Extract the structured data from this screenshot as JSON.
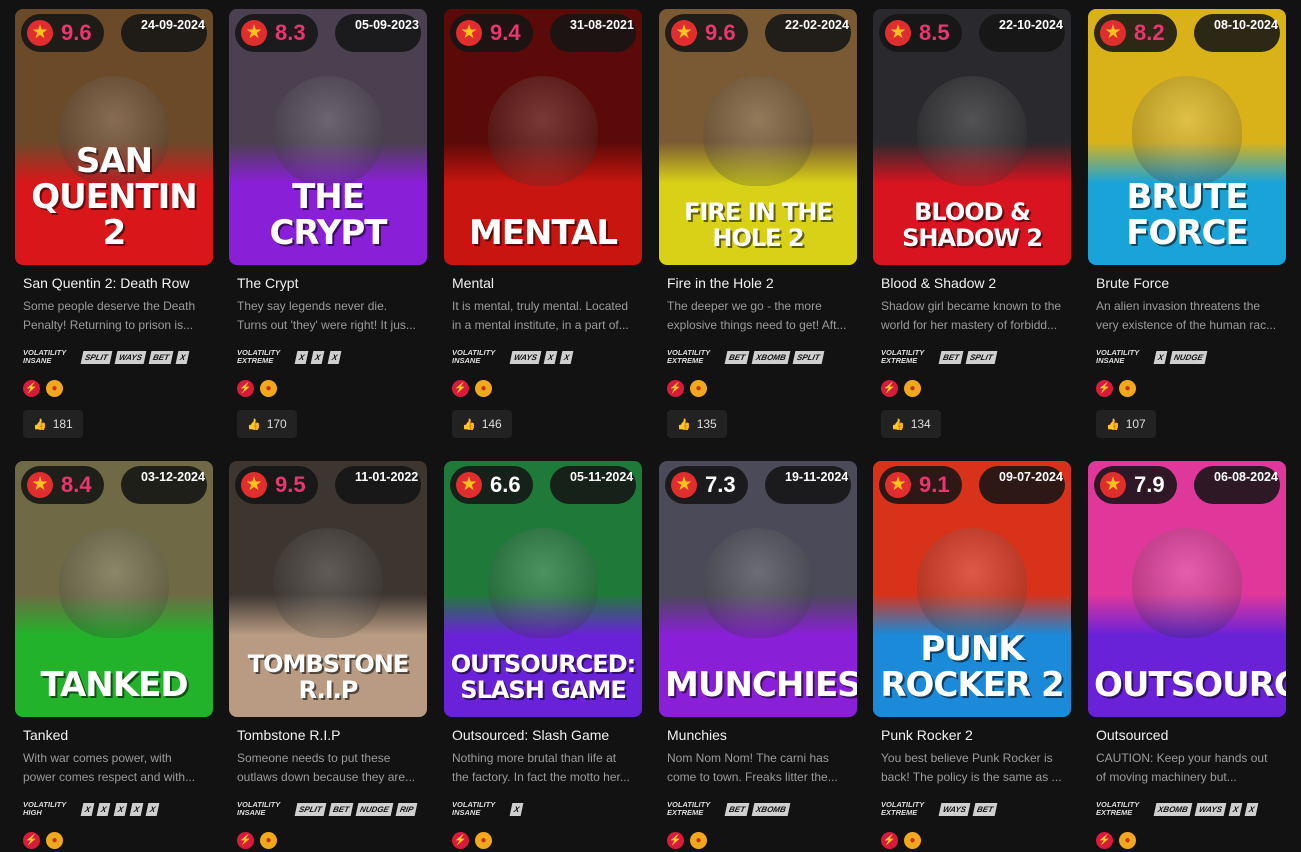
{
  "cards": [
    {
      "score": "9.6",
      "score_color": "#e8366f",
      "date": "24-09-2024",
      "logo": "San Quentin 2",
      "title": "San Quentin 2: Death Row",
      "desc": "Some people deserve the Death Penalty! Returning to prison is...",
      "volatility": "VOLATILITY INSANE",
      "features": [
        "SPLIT",
        "WAYS",
        "BET",
        "X"
      ],
      "likes": "181",
      "colors": [
        "#6b4a2a",
        "#d9171a"
      ]
    },
    {
      "score": "8.3",
      "score_color": "#e8366f",
      "date": "05-09-2023",
      "logo": "The Crypt",
      "title": "The Crypt",
      "desc": "They say legends never die. Turns out 'they' were right! It jus...",
      "volatility": "VOLATILITY EXTREME",
      "features": [
        "X",
        "X",
        "X"
      ],
      "likes": "170",
      "colors": [
        "#4a4050",
        "#8a1fd8"
      ]
    },
    {
      "score": "9.4",
      "score_color": "#e8366f",
      "date": "31-08-2021",
      "logo": "Mental",
      "title": "Mental",
      "desc": "It is mental, truly mental. Located in a mental institute, in a part of...",
      "volatility": "VOLATILITY INSANE",
      "features": [
        "WAYS",
        "X",
        "X"
      ],
      "likes": "146",
      "colors": [
        "#5a0a08",
        "#c8150f"
      ]
    },
    {
      "score": "9.6",
      "score_color": "#e8366f",
      "date": "22-02-2024",
      "logo": "Fire in the Hole 2",
      "title": "Fire in the Hole 2",
      "desc": "The deeper we go - the more explosive things need to get! Aft...",
      "volatility": "VOLATILITY EXTREME",
      "features": [
        "BET",
        "XBOMB",
        "SPLIT"
      ],
      "likes": "135",
      "colors": [
        "#7a5a34",
        "#d8d118"
      ]
    },
    {
      "score": "8.5",
      "score_color": "#e8366f",
      "date": "22-10-2024",
      "logo": "Blood & Shadow 2",
      "title": "Blood & Shadow 2",
      "desc": "Shadow girl became known to the world for her mastery of forbidd...",
      "volatility": "VOLATILITY EXTREME",
      "features": [
        "BET",
        "SPLIT"
      ],
      "likes": "134",
      "colors": [
        "#2a2a2e",
        "#d71420"
      ]
    },
    {
      "score": "8.2",
      "score_color": "#e8366f",
      "date": "08-10-2024",
      "logo": "Brute Force",
      "title": "Brute Force",
      "desc": "An alien invasion threatens the very existence of the human rac...",
      "volatility": "VOLATILITY INSANE",
      "features": [
        "X",
        "NUDGE"
      ],
      "likes": "107",
      "colors": [
        "#d9b21a",
        "#1aa3d9"
      ]
    },
    {
      "score": "8.4",
      "score_color": "#e8366f",
      "date": "03-12-2024",
      "logo": "Tanked",
      "title": "Tanked",
      "desc": "With war comes power, with power comes respect and with...",
      "volatility": "VOLATILITY HIGH",
      "features": [
        "X",
        "X",
        "X",
        "X",
        "X"
      ],
      "likes": "",
      "colors": [
        "#6f6a45",
        "#22b32a"
      ]
    },
    {
      "score": "9.5",
      "score_color": "#e8366f",
      "date": "11-01-2022",
      "logo": "Tombstone R.I.P",
      "title": "Tombstone R.I.P",
      "desc": "Someone needs to put these outlaws down because they are...",
      "volatility": "VOLATILITY INSANE",
      "features": [
        "SPLIT",
        "BET",
        "NUDGE",
        "RIP"
      ],
      "likes": "",
      "colors": [
        "#3c3530",
        "#b89b82"
      ]
    },
    {
      "score": "6.6",
      "score_color": "#ffffff",
      "date": "05-11-2024",
      "logo": "Outsourced: Slash Game",
      "title": "Outsourced: Slash Game",
      "desc": "Nothing more brutal than life at the factory. In fact the motto her...",
      "volatility": "VOLATILITY INSANE",
      "features": [
        "X"
      ],
      "likes": "",
      "colors": [
        "#1f7a3a",
        "#6a22d9"
      ]
    },
    {
      "score": "7.3",
      "score_color": "#ffffff",
      "date": "19-11-2024",
      "logo": "Munchies",
      "title": "Munchies",
      "desc": "Nom Nom Nom! The carni has come to town. Freaks litter the...",
      "volatility": "VOLATILITY EXTREME",
      "features": [
        "BET",
        "XBOMB"
      ],
      "likes": "",
      "colors": [
        "#4a4a58",
        "#8a1fd8"
      ]
    },
    {
      "score": "9.1",
      "score_color": "#e8366f",
      "date": "09-07-2024",
      "logo": "Punk Rocker 2",
      "title": "Punk Rocker 2",
      "desc": "You best believe Punk Rocker is back! The policy is the same as ...",
      "volatility": "VOLATILITY EXTREME",
      "features": [
        "WAYS",
        "BET"
      ],
      "likes": "",
      "colors": [
        "#d8321a",
        "#1a8ad9"
      ]
    },
    {
      "score": "7.9",
      "score_color": "#ffffff",
      "date": "06-08-2024",
      "logo": "Outsourced",
      "title": "Outsourced",
      "desc": "CAUTION: Keep your hands out of moving machinery but...",
      "volatility": "VOLATILITY EXTREME",
      "features": [
        "XBOMB",
        "WAYS",
        "X",
        "X"
      ],
      "likes": "",
      "colors": [
        "#e0379a",
        "#6a22d9"
      ]
    }
  ]
}
